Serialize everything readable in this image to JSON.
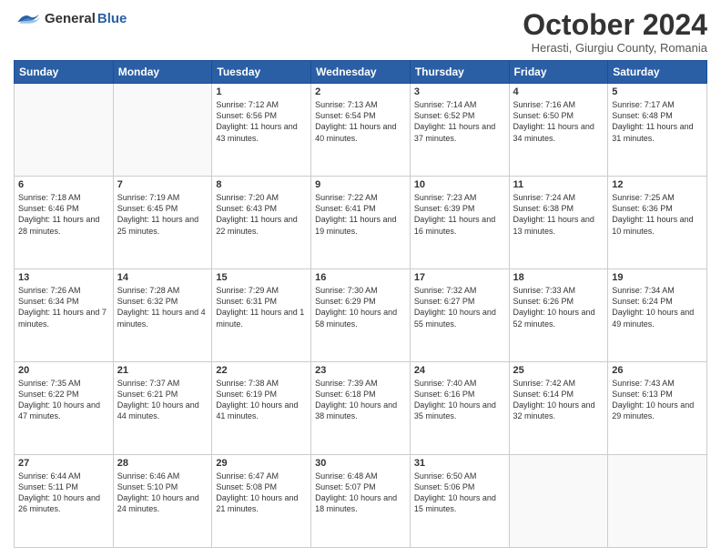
{
  "logo": {
    "general": "General",
    "blue": "Blue"
  },
  "header": {
    "month": "October 2024",
    "location": "Herasti, Giurgiu County, Romania"
  },
  "weekdays": [
    "Sunday",
    "Monday",
    "Tuesday",
    "Wednesday",
    "Thursday",
    "Friday",
    "Saturday"
  ],
  "weeks": [
    [
      {
        "day": "",
        "sunrise": "",
        "sunset": "",
        "daylight": ""
      },
      {
        "day": "",
        "sunrise": "",
        "sunset": "",
        "daylight": ""
      },
      {
        "day": "1",
        "sunrise": "Sunrise: 7:12 AM",
        "sunset": "Sunset: 6:56 PM",
        "daylight": "Daylight: 11 hours and 43 minutes."
      },
      {
        "day": "2",
        "sunrise": "Sunrise: 7:13 AM",
        "sunset": "Sunset: 6:54 PM",
        "daylight": "Daylight: 11 hours and 40 minutes."
      },
      {
        "day": "3",
        "sunrise": "Sunrise: 7:14 AM",
        "sunset": "Sunset: 6:52 PM",
        "daylight": "Daylight: 11 hours and 37 minutes."
      },
      {
        "day": "4",
        "sunrise": "Sunrise: 7:16 AM",
        "sunset": "Sunset: 6:50 PM",
        "daylight": "Daylight: 11 hours and 34 minutes."
      },
      {
        "day": "5",
        "sunrise": "Sunrise: 7:17 AM",
        "sunset": "Sunset: 6:48 PM",
        "daylight": "Daylight: 11 hours and 31 minutes."
      }
    ],
    [
      {
        "day": "6",
        "sunrise": "Sunrise: 7:18 AM",
        "sunset": "Sunset: 6:46 PM",
        "daylight": "Daylight: 11 hours and 28 minutes."
      },
      {
        "day": "7",
        "sunrise": "Sunrise: 7:19 AM",
        "sunset": "Sunset: 6:45 PM",
        "daylight": "Daylight: 11 hours and 25 minutes."
      },
      {
        "day": "8",
        "sunrise": "Sunrise: 7:20 AM",
        "sunset": "Sunset: 6:43 PM",
        "daylight": "Daylight: 11 hours and 22 minutes."
      },
      {
        "day": "9",
        "sunrise": "Sunrise: 7:22 AM",
        "sunset": "Sunset: 6:41 PM",
        "daylight": "Daylight: 11 hours and 19 minutes."
      },
      {
        "day": "10",
        "sunrise": "Sunrise: 7:23 AM",
        "sunset": "Sunset: 6:39 PM",
        "daylight": "Daylight: 11 hours and 16 minutes."
      },
      {
        "day": "11",
        "sunrise": "Sunrise: 7:24 AM",
        "sunset": "Sunset: 6:38 PM",
        "daylight": "Daylight: 11 hours and 13 minutes."
      },
      {
        "day": "12",
        "sunrise": "Sunrise: 7:25 AM",
        "sunset": "Sunset: 6:36 PM",
        "daylight": "Daylight: 11 hours and 10 minutes."
      }
    ],
    [
      {
        "day": "13",
        "sunrise": "Sunrise: 7:26 AM",
        "sunset": "Sunset: 6:34 PM",
        "daylight": "Daylight: 11 hours and 7 minutes."
      },
      {
        "day": "14",
        "sunrise": "Sunrise: 7:28 AM",
        "sunset": "Sunset: 6:32 PM",
        "daylight": "Daylight: 11 hours and 4 minutes."
      },
      {
        "day": "15",
        "sunrise": "Sunrise: 7:29 AM",
        "sunset": "Sunset: 6:31 PM",
        "daylight": "Daylight: 11 hours and 1 minute."
      },
      {
        "day": "16",
        "sunrise": "Sunrise: 7:30 AM",
        "sunset": "Sunset: 6:29 PM",
        "daylight": "Daylight: 10 hours and 58 minutes."
      },
      {
        "day": "17",
        "sunrise": "Sunrise: 7:32 AM",
        "sunset": "Sunset: 6:27 PM",
        "daylight": "Daylight: 10 hours and 55 minutes."
      },
      {
        "day": "18",
        "sunrise": "Sunrise: 7:33 AM",
        "sunset": "Sunset: 6:26 PM",
        "daylight": "Daylight: 10 hours and 52 minutes."
      },
      {
        "day": "19",
        "sunrise": "Sunrise: 7:34 AM",
        "sunset": "Sunset: 6:24 PM",
        "daylight": "Daylight: 10 hours and 49 minutes."
      }
    ],
    [
      {
        "day": "20",
        "sunrise": "Sunrise: 7:35 AM",
        "sunset": "Sunset: 6:22 PM",
        "daylight": "Daylight: 10 hours and 47 minutes."
      },
      {
        "day": "21",
        "sunrise": "Sunrise: 7:37 AM",
        "sunset": "Sunset: 6:21 PM",
        "daylight": "Daylight: 10 hours and 44 minutes."
      },
      {
        "day": "22",
        "sunrise": "Sunrise: 7:38 AM",
        "sunset": "Sunset: 6:19 PM",
        "daylight": "Daylight: 10 hours and 41 minutes."
      },
      {
        "day": "23",
        "sunrise": "Sunrise: 7:39 AM",
        "sunset": "Sunset: 6:18 PM",
        "daylight": "Daylight: 10 hours and 38 minutes."
      },
      {
        "day": "24",
        "sunrise": "Sunrise: 7:40 AM",
        "sunset": "Sunset: 6:16 PM",
        "daylight": "Daylight: 10 hours and 35 minutes."
      },
      {
        "day": "25",
        "sunrise": "Sunrise: 7:42 AM",
        "sunset": "Sunset: 6:14 PM",
        "daylight": "Daylight: 10 hours and 32 minutes."
      },
      {
        "day": "26",
        "sunrise": "Sunrise: 7:43 AM",
        "sunset": "Sunset: 6:13 PM",
        "daylight": "Daylight: 10 hours and 29 minutes."
      }
    ],
    [
      {
        "day": "27",
        "sunrise": "Sunrise: 6:44 AM",
        "sunset": "Sunset: 5:11 PM",
        "daylight": "Daylight: 10 hours and 26 minutes."
      },
      {
        "day": "28",
        "sunrise": "Sunrise: 6:46 AM",
        "sunset": "Sunset: 5:10 PM",
        "daylight": "Daylight: 10 hours and 24 minutes."
      },
      {
        "day": "29",
        "sunrise": "Sunrise: 6:47 AM",
        "sunset": "Sunset: 5:08 PM",
        "daylight": "Daylight: 10 hours and 21 minutes."
      },
      {
        "day": "30",
        "sunrise": "Sunrise: 6:48 AM",
        "sunset": "Sunset: 5:07 PM",
        "daylight": "Daylight: 10 hours and 18 minutes."
      },
      {
        "day": "31",
        "sunrise": "Sunrise: 6:50 AM",
        "sunset": "Sunset: 5:06 PM",
        "daylight": "Daylight: 10 hours and 15 minutes."
      },
      {
        "day": "",
        "sunrise": "",
        "sunset": "",
        "daylight": ""
      },
      {
        "day": "",
        "sunrise": "",
        "sunset": "",
        "daylight": ""
      }
    ]
  ]
}
